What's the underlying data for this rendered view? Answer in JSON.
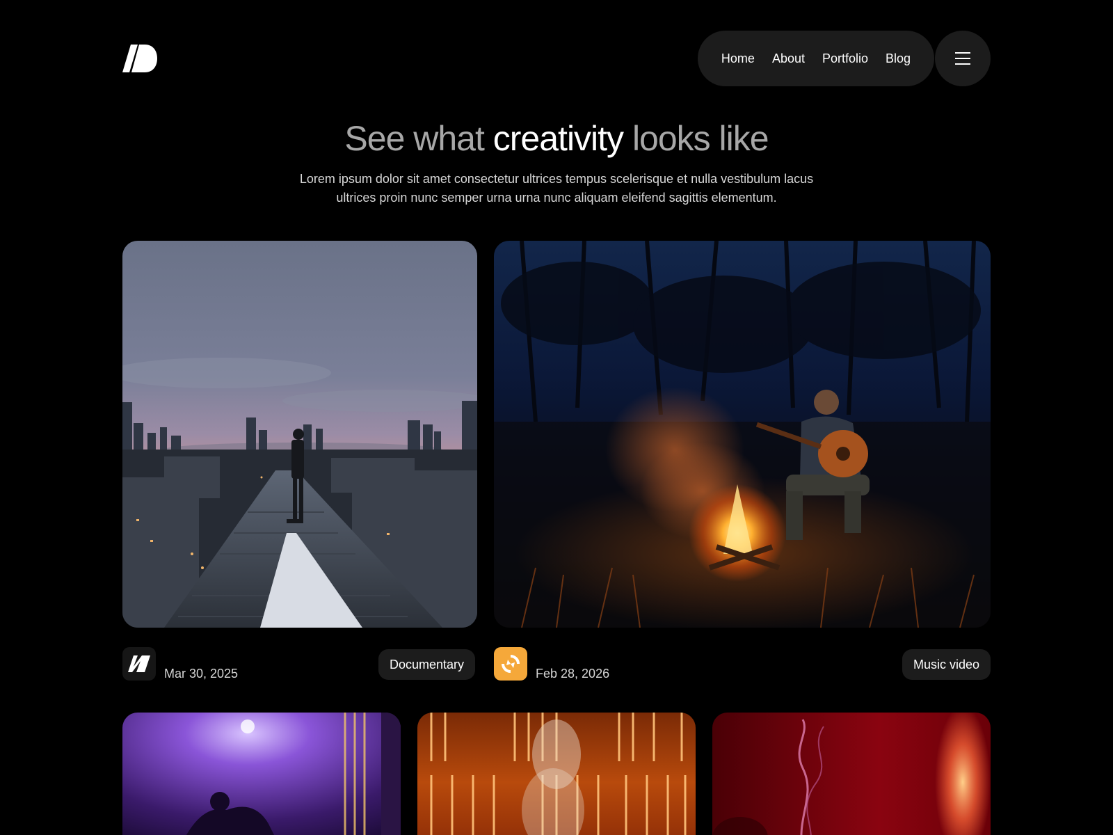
{
  "header": {
    "logo_icon": "brand-logo-icon",
    "nav": [
      {
        "label": "Home"
      },
      {
        "label": "About"
      },
      {
        "label": "Portfolio"
      },
      {
        "label": "Blog"
      }
    ],
    "menu_icon": "hamburger-menu-icon"
  },
  "hero": {
    "title_before": "See what ",
    "title_emphasis": "creativity",
    "title_after": " looks like",
    "subtitle_line1": "Lorem ipsum dolor sit amet consectetur ultrices tempus scelerisque et nulla vestibulum lacus",
    "subtitle_line2": "ultrices proin nunc semper urna urna nunc aliquam eleifend sagittis elementum."
  },
  "projects": [
    {
      "image": "city-rooftop-dusk-photo",
      "client_icon": "client-logo-black-icon",
      "date": "Mar 30, 2025",
      "category": "Documentary"
    },
    {
      "image": "campfire-guitarist-photo",
      "client_icon": "client-logo-orange-icon",
      "date": "Feb 28, 2026",
      "category": "Music video"
    },
    {
      "image": "purple-stage-camera-photo"
    },
    {
      "image": "orange-neon-smoke-photo"
    },
    {
      "image": "red-smoke-photo"
    }
  ],
  "colors": {
    "background": "#000000",
    "pill": "#1c1c1c",
    "accent_orange": "#f5a83a",
    "muted_title": "#a7a7a7"
  }
}
